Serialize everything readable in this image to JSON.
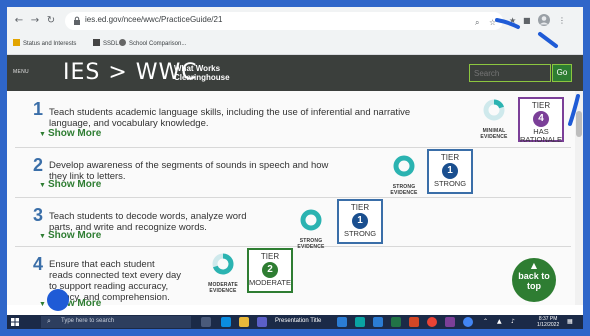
{
  "browser": {
    "url": "ies.ed.gov/ncee/wwc/PracticeGuide/21",
    "bookmarks": [
      "Status and Interests",
      "SSDL",
      "School Comparison..."
    ]
  },
  "site": {
    "menu_label": "MENU",
    "logo": "IES > WWC",
    "subtitle_line1": "What Works",
    "subtitle_line2": "Clearinghouse",
    "search_placeholder": "Search",
    "go_label": "Go"
  },
  "recommendations": [
    {
      "number": "1",
      "text_line1": "Teach students academic language skills, including the use of inferential and narrative",
      "text_line2": "language, and vocabulary knowledge.",
      "show_more": "Show More",
      "evidence_line1": "MINIMAL",
      "evidence_line2": "EVIDENCE",
      "tier_title": "TIER",
      "tier_number": "4",
      "tier_level_line1": "HAS",
      "tier_level_line2": "RATIONALE",
      "color": "#7b3f98"
    },
    {
      "number": "2",
      "text_line1": "Develop awareness of the segments of sounds in speech and how",
      "text_line2": "they link to letters.",
      "show_more": "Show More",
      "evidence_line1": "STRONG",
      "evidence_line2": "EVIDENCE",
      "tier_title": "TIER",
      "tier_number": "1",
      "tier_level_line1": "STRONG",
      "tier_level_line2": "",
      "color": "#1a4f8f"
    },
    {
      "number": "3",
      "text_line1": "Teach students to decode words, analyze word",
      "text_line2": "parts, and write and recognize words.",
      "show_more": "Show More",
      "evidence_line1": "STRONG",
      "evidence_line2": "EVIDENCE",
      "tier_title": "TIER",
      "tier_number": "1",
      "tier_level_line1": "STRONG",
      "tier_level_line2": "",
      "color": "#1a4f8f"
    },
    {
      "number": "4",
      "text_line1": "Ensure that each student",
      "text_line2": "reads connected text every day",
      "text_line3": "to support reading accuracy,",
      "text_line4": "fluency, and comprehension.",
      "show_more": "Show More",
      "evidence_line1": "MODERATE",
      "evidence_line2": "EVIDENCE",
      "tier_title": "TIER",
      "tier_number": "2",
      "tier_level_line1": "MODERATE",
      "tier_level_line2": "",
      "color": "#2e7d32"
    }
  ],
  "back_to_top": {
    "line1": "back to",
    "line2": "top"
  },
  "taskbar": {
    "search_placeholder": "Type here to search",
    "tooltip": "Presentation Title",
    "time": "8:37 PM",
    "date": "1/12/2022"
  },
  "colors": {
    "accent_green": "#2e7d32",
    "tier_blue": "#3a6ea8",
    "tier_purple": "#7b3f98",
    "header_bg": "#3b3f3c",
    "donut_teal": "#2bb3b1"
  }
}
